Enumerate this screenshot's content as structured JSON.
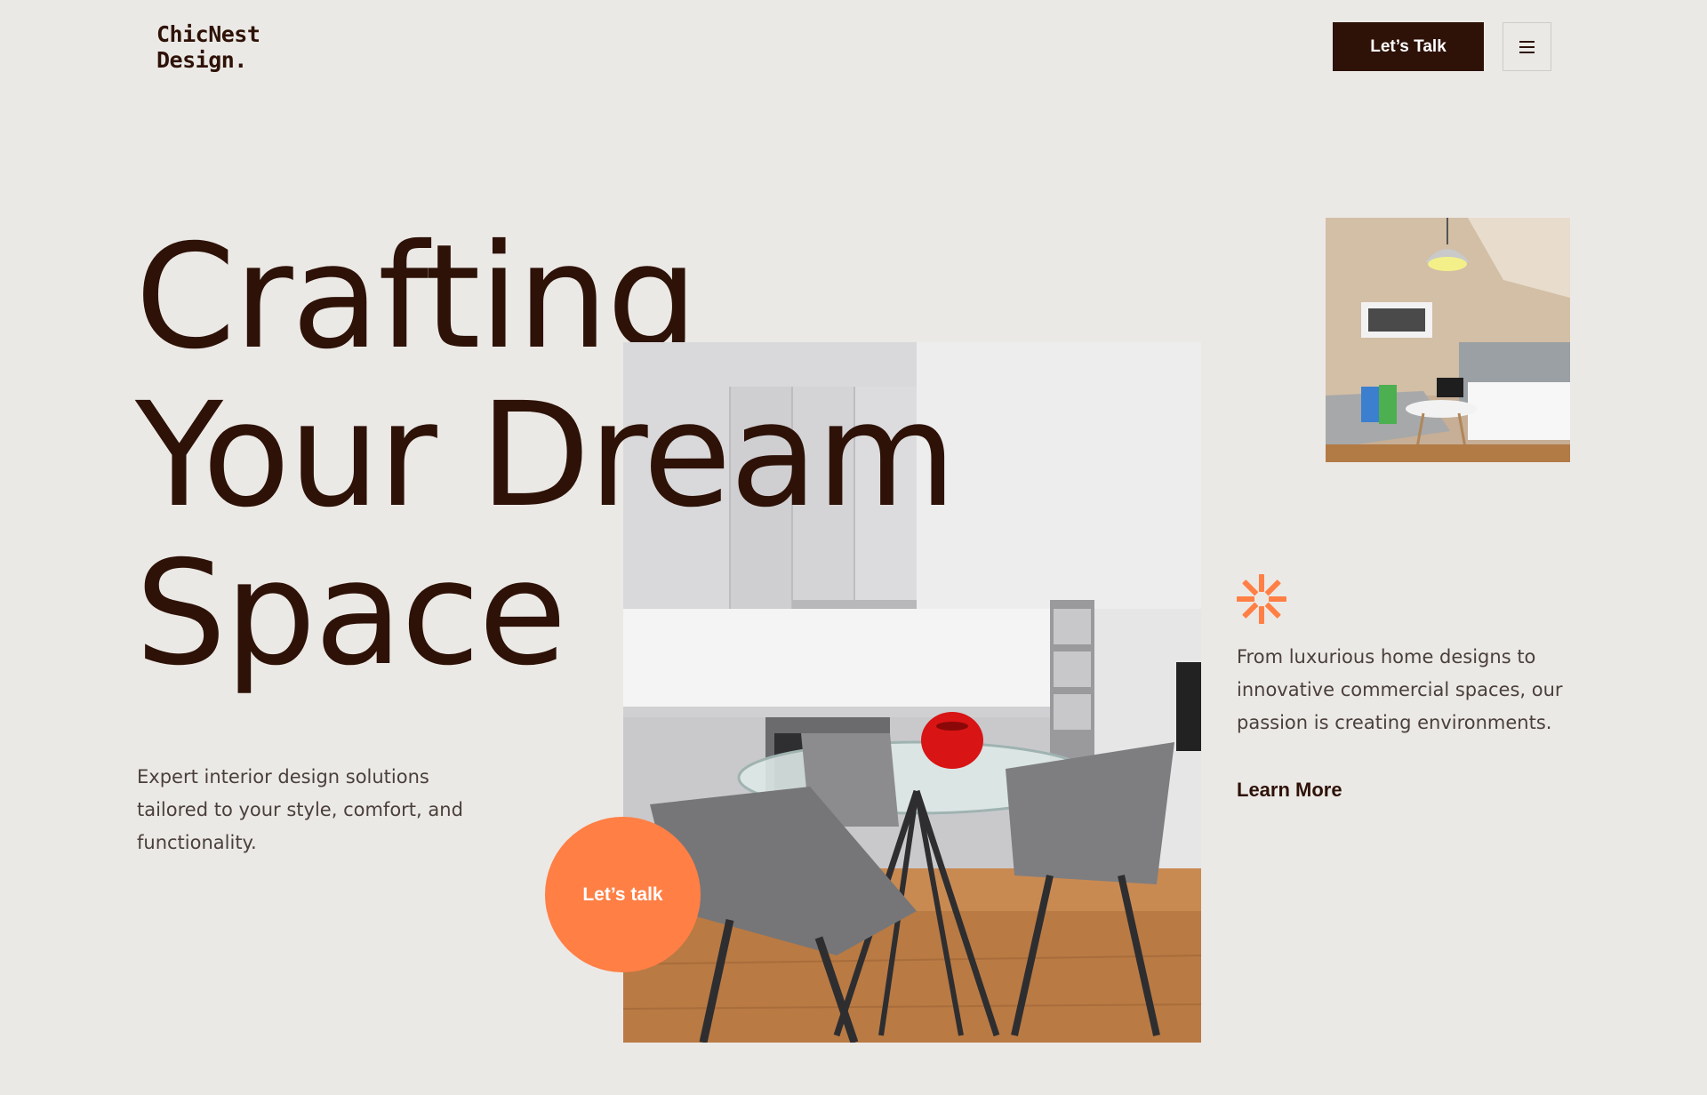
{
  "header": {
    "logo_line1": "ChicNest",
    "logo_line2": "Design.",
    "cta_label": "Let’s Talk",
    "menu_icon": "hamburger-menu-icon"
  },
  "hero": {
    "headline_line1": "Crafting",
    "headline_line2": "Your Dream",
    "headline_line3": "Space",
    "intro_text": "Expert interior design solutions tailored to your style, comfort, and functionality.",
    "circle_cta_label": "Let’s talk"
  },
  "aside": {
    "decor_icon": "asterisk-burst-icon",
    "description": "From luxurious home designs to innovative commercial spaces, our passion is creating environments.",
    "learn_more_label": "Learn More"
  },
  "colors": {
    "background": "#EBE9E6",
    "primary_dark": "#2E1207",
    "accent_orange": "#FF7F45",
    "body_text": "#4A3F3A"
  }
}
